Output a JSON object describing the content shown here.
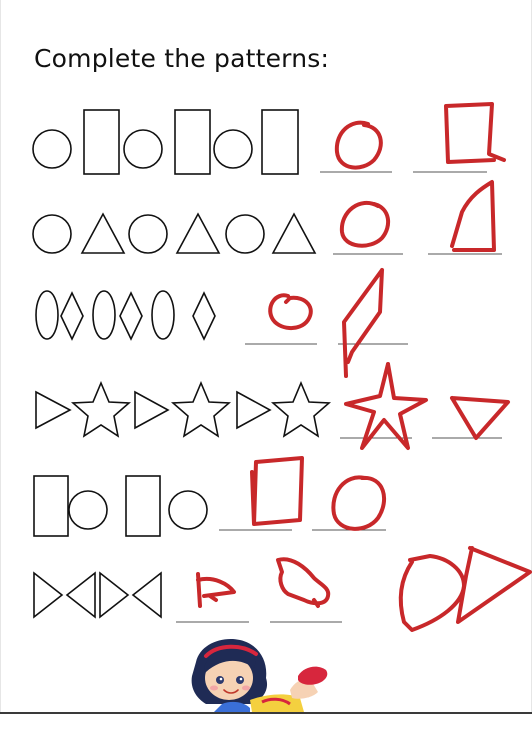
{
  "worksheet": {
    "title": "Complete the patterns:",
    "rows": [
      {
        "pattern": [
          "circle",
          "rectangle",
          "circle",
          "rectangle",
          "circle",
          "rectangle"
        ],
        "blanks": 2,
        "answers": [
          "circle",
          "rectangle"
        ]
      },
      {
        "pattern": [
          "circle",
          "triangle",
          "circle",
          "triangle",
          "circle",
          "triangle"
        ],
        "blanks": 2,
        "answers": [
          "circle",
          "triangle"
        ]
      },
      {
        "pattern": [
          "oval",
          "diamond",
          "oval",
          "diamond",
          "oval",
          "diamond"
        ],
        "blanks": 2,
        "answers": [
          "oval",
          "diamond"
        ]
      },
      {
        "pattern": [
          "triangle-right",
          "star",
          "triangle-right",
          "star",
          "triangle-right",
          "star"
        ],
        "blanks": 2,
        "answers": [
          "star",
          "triangle-right"
        ]
      },
      {
        "pattern": [
          "rectangle",
          "circle",
          "rectangle",
          "circle"
        ],
        "blanks": 2,
        "answers": [
          "rectangle",
          "circle"
        ]
      },
      {
        "pattern": [
          "triangle-right",
          "triangle-left",
          "triangle-right",
          "triangle-left"
        ],
        "blanks": 2,
        "answers": [
          "triangle-right",
          "triangle-left"
        ]
      }
    ],
    "answer_color": "#c8282a",
    "ink_color": "#111111",
    "illustration": "girl-reading-icon"
  }
}
